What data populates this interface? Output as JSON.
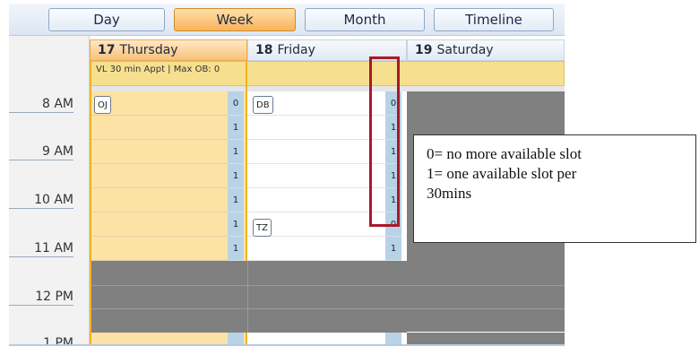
{
  "views": [
    "Day",
    "Week",
    "Month",
    "Timeline"
  ],
  "active_view": "Week",
  "days": [
    {
      "num": "17",
      "name": "Thursday"
    },
    {
      "num": "18",
      "name": "Friday"
    },
    {
      "num": "19",
      "name": "Saturday"
    }
  ],
  "info_bar": "VL 30 min Appt | Max OB: 0",
  "time_labels": [
    "8 AM",
    "9 AM",
    "10 AM",
    "11 AM",
    "12 PM",
    "1 PM"
  ],
  "thursday_slots": [
    "0",
    "1",
    "1",
    "1",
    "1",
    "1",
    "1"
  ],
  "friday_slots": [
    "0",
    "1",
    "1",
    "1",
    "1",
    "0",
    "1"
  ],
  "appointments": [
    {
      "day": "Thursday",
      "label": "OJ"
    },
    {
      "day": "Friday",
      "label": "DB"
    },
    {
      "day": "Friday",
      "label": "TZ"
    }
  ],
  "callout": {
    "line1": "0= no more available slot",
    "line2": "1= one available slot per",
    "line3": "30mins"
  },
  "colors": {
    "thursday_bg": "#fde2a6",
    "thursday_line": "#f0b323",
    "closed": "#808080",
    "slot_badge": "#b9d3e6",
    "highlight_border": "#a9182a",
    "info_bar": "#f6e08f"
  }
}
